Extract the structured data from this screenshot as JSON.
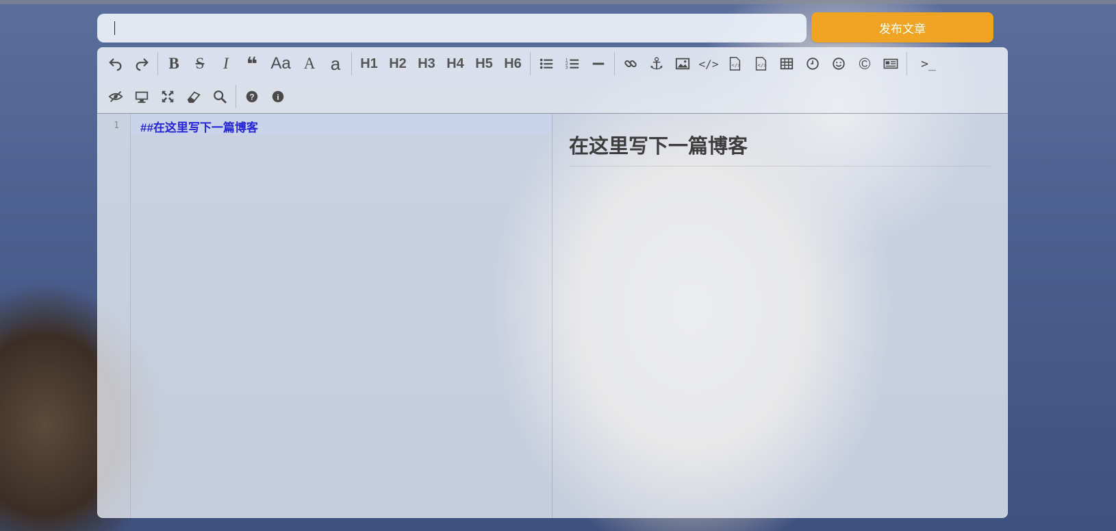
{
  "title_input": {
    "value": "",
    "placeholder": ""
  },
  "publish_button": {
    "label": "发布文章",
    "color": "#f0a424"
  },
  "toolbar": {
    "row1": [
      {
        "icon": "undo-icon",
        "glyph": "↶"
      },
      {
        "icon": "redo-icon",
        "glyph": "↷"
      },
      {
        "icon": "bold-icon",
        "glyph": "B"
      },
      {
        "icon": "strikethrough-icon",
        "glyph": "S"
      },
      {
        "icon": "italic-icon",
        "glyph": "I"
      },
      {
        "icon": "quote-icon",
        "glyph": "❝"
      },
      {
        "icon": "uppercase-icon",
        "glyph": "Aa"
      },
      {
        "icon": "font-a-upper-icon",
        "glyph": "A"
      },
      {
        "icon": "font-a-lower-icon",
        "glyph": "a"
      },
      {
        "label": "H1"
      },
      {
        "label": "H2"
      },
      {
        "label": "H3"
      },
      {
        "label": "H4"
      },
      {
        "label": "H5"
      },
      {
        "label": "H6"
      },
      {
        "icon": "unordered-list-icon",
        "glyph": "☰"
      },
      {
        "icon": "ordered-list-icon",
        "glyph": "≡"
      },
      {
        "icon": "horizontal-rule-icon",
        "glyph": "━"
      },
      {
        "icon": "link-icon",
        "glyph": "🔗"
      },
      {
        "icon": "anchor-icon",
        "glyph": "⚓"
      },
      {
        "icon": "image-icon",
        "glyph": "▣"
      },
      {
        "icon": "code-icon",
        "glyph": "</>"
      },
      {
        "icon": "code-block-icon",
        "glyph": "⌸"
      },
      {
        "icon": "preformatted-icon",
        "glyph": "⌸"
      },
      {
        "icon": "table-icon",
        "glyph": "▦"
      },
      {
        "icon": "datetime-icon",
        "glyph": "◷"
      },
      {
        "icon": "emoji-icon",
        "glyph": "☺"
      },
      {
        "icon": "html-entities-icon",
        "glyph": "©"
      },
      {
        "icon": "pagebreak-icon",
        "glyph": "▤"
      },
      {
        "icon": "terminal-icon",
        "glyph": ">_"
      }
    ],
    "row2": [
      {
        "icon": "toggle-preview-icon",
        "glyph": "◉"
      },
      {
        "icon": "watch-icon",
        "glyph": "▭"
      },
      {
        "icon": "fullscreen-icon",
        "glyph": "⤢"
      },
      {
        "icon": "clear-icon",
        "glyph": "◇"
      },
      {
        "icon": "search-icon",
        "glyph": "⚲"
      },
      {
        "icon": "help-icon",
        "glyph": "?"
      },
      {
        "icon": "info-icon",
        "glyph": "i"
      }
    ]
  },
  "editor": {
    "line_number": "1",
    "code": "##在这里写下一篇博客"
  },
  "preview": {
    "heading": "在这里写下一篇博客"
  }
}
